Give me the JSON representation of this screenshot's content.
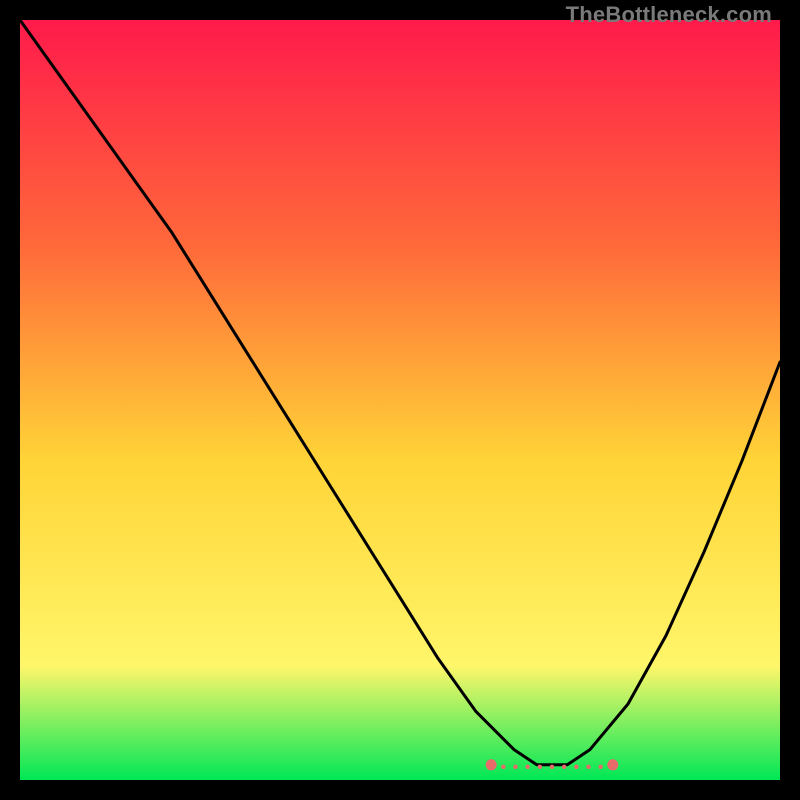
{
  "watermark": "TheBottleneck.com",
  "chart_data": {
    "type": "line",
    "title": "",
    "xlabel": "",
    "ylabel": "",
    "xlim": [
      0,
      100
    ],
    "ylim": [
      0,
      100
    ],
    "grid": false,
    "legend": false,
    "background_gradient": {
      "top_color": "#ff1a4b",
      "mid_color_1": "#ff6a3a",
      "mid_color_2": "#ffd437",
      "mid_color_3": "#fff66a",
      "bottom_color": "#00e756"
    },
    "series": [
      {
        "name": "bottleneck-curve",
        "stroke": "#000000",
        "x": [
          0,
          5,
          10,
          15,
          20,
          25,
          30,
          35,
          40,
          45,
          50,
          55,
          60,
          65,
          68,
          70,
          72,
          75,
          80,
          85,
          90,
          95,
          100
        ],
        "values": [
          100,
          93,
          86,
          79,
          72,
          64,
          56,
          48,
          40,
          32,
          24,
          16,
          9,
          4,
          2,
          2,
          2,
          4,
          10,
          19,
          30,
          42,
          55
        ]
      }
    ],
    "optimal_zone": {
      "x_start": 62,
      "x_end": 78,
      "marker_color": "#e86a6a",
      "label": ""
    }
  }
}
